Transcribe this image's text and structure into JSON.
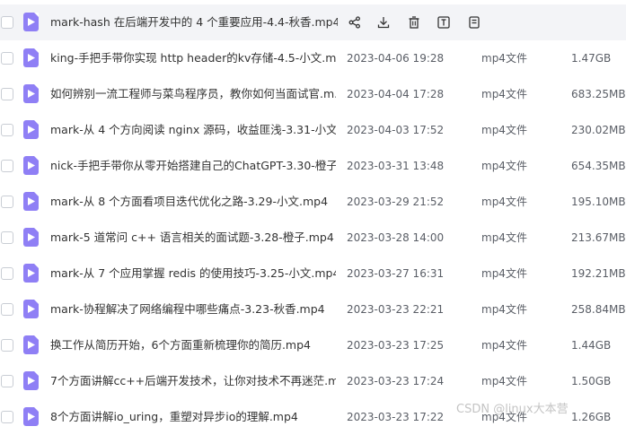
{
  "files": [
    {
      "name": "mark-hash 在后端开发中的 4 个重要应用-4.4-秋香.mp4",
      "date": "",
      "type": "",
      "size": "",
      "hovered": true
    },
    {
      "name": "king-手把手带你实现 http header的kv存储-4.5-小文.m...",
      "date": "2023-04-06 19:28",
      "type": "mp4文件",
      "size": "1.47GB"
    },
    {
      "name": "如何辨别一流工程师与菜鸟程序员，教你如何当面试官.m...",
      "date": "2023-04-04 17:28",
      "type": "mp4文件",
      "size": "683.25MB"
    },
    {
      "name": "mark-从 4 个方向阅读 nginx 源码，收益匪浅-3.31-小文...",
      "date": "2023-04-03 17:52",
      "type": "mp4文件",
      "size": "230.02MB"
    },
    {
      "name": "nick-手把手带你从零开始搭建自己的ChatGPT-3.30-橙子...",
      "date": "2023-03-31 13:48",
      "type": "mp4文件",
      "size": "654.35MB"
    },
    {
      "name": "mark-从 8 个方面看项目迭代优化之路-3.29-小文.mp4",
      "date": "2023-03-29 21:52",
      "type": "mp4文件",
      "size": "195.10MB"
    },
    {
      "name": "mark-5 道常问 c++ 语言相关的面试题-3.28-橙子.mp4",
      "date": "2023-03-28 14:00",
      "type": "mp4文件",
      "size": "213.67MB"
    },
    {
      "name": "mark-从 7 个应用掌握 redis 的使用技巧-3.25-小文.mp4",
      "date": "2023-03-27 16:31",
      "type": "mp4文件",
      "size": "192.21MB"
    },
    {
      "name": "mark-协程解决了网络编程中哪些痛点-3.23-秋香.mp4",
      "date": "2023-03-23 22:21",
      "type": "mp4文件",
      "size": "258.84MB"
    },
    {
      "name": "换工作从简历开始，6个方面重新梳理你的简历.mp4",
      "date": "2023-03-23 17:25",
      "type": "mp4文件",
      "size": "1.44GB"
    },
    {
      "name": "7个方面讲解cc++后端开发技术，让你对技术不再迷茫.m...",
      "date": "2023-03-23 17:24",
      "type": "mp4文件",
      "size": "1.50GB"
    },
    {
      "name": "8个方面讲解io_uring，重塑对异步io的理解.mp4",
      "date": "2023-03-23 17:22",
      "type": "mp4文件",
      "size": "1.26GB"
    }
  ],
  "row_actions": [
    "share-icon",
    "download-icon",
    "delete-icon",
    "text-icon",
    "more-icon"
  ],
  "watermark": "CSDN @linux大本营",
  "colors": {
    "file_icon": "#8f7ff5",
    "hover_bg": "#f3f4f7",
    "text": "#333333",
    "meta_text": "#5a5e66"
  }
}
